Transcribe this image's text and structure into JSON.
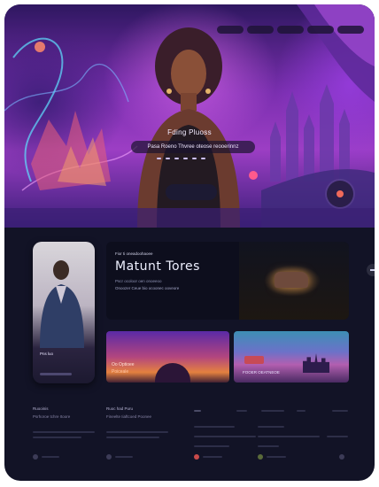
{
  "hero": {
    "nav": [
      "",
      "",
      "",
      "",
      ""
    ],
    "title": "Fding Pluoss",
    "subtitle": "Pasa Roeno Thvree oteose reooerinnz",
    "button": "",
    "colors": {
      "accent": "#a855f7",
      "fab_dot": "#f06a5a"
    }
  },
  "profile_card": {
    "caption": "Pns luo"
  },
  "feature": {
    "kicker": "Fior ti oneadoohaoee",
    "title": "Matunt Tores",
    "line1": "Pscr ocoloor oen onoeeoo",
    "line2": "Onoozer Ceue bio ocoonec ooveore"
  },
  "cards": [
    {
      "line1": "Oo Optioee",
      "line2": "Poiceale"
    },
    {
      "line1": "FOOER OEATNEOE"
    }
  ],
  "footer": {
    "col1": {
      "title": "Ruooinis",
      "sub": "Psrhoroe tchre Itoore"
    },
    "col2": {
      "title": "Ruoc had Puru",
      "sub": "Fineelte Iiaftcoed Poonee"
    }
  }
}
